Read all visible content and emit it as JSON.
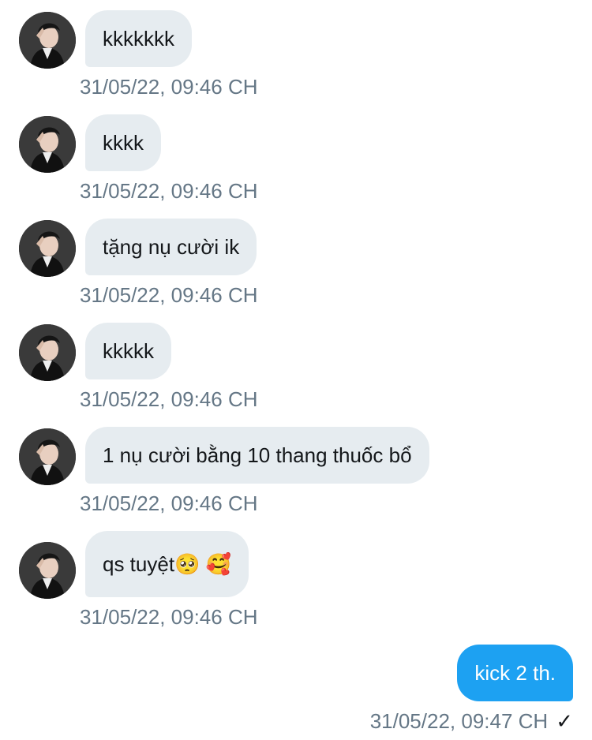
{
  "messages": [
    {
      "sender": "other",
      "text": "kkkkkkk",
      "timestamp": "31/05/22, 09:46 CH"
    },
    {
      "sender": "other",
      "text": "kkkk",
      "timestamp": "31/05/22, 09:46 CH"
    },
    {
      "sender": "other",
      "text": "tặng nụ cười ik",
      "timestamp": "31/05/22, 09:46 CH"
    },
    {
      "sender": "other",
      "text": "kkkkk",
      "timestamp": "31/05/22, 09:46 CH"
    },
    {
      "sender": "other",
      "text": "1 nụ cười bằng 10 thang thuốc bổ",
      "timestamp": "31/05/22, 09:46 CH"
    },
    {
      "sender": "other",
      "text": "qs tuyệt🥺 🥰",
      "timestamp": "31/05/22, 09:46 CH"
    },
    {
      "sender": "me",
      "text": "kick 2 th.",
      "timestamp": "31/05/22, 09:47 CH",
      "status_glyph": "✓"
    }
  ],
  "colors": {
    "incoming_bubble": "#e6ecf0",
    "outgoing_bubble": "#1da1f2",
    "timestamp_text": "#657786",
    "message_text": "#14171a"
  }
}
